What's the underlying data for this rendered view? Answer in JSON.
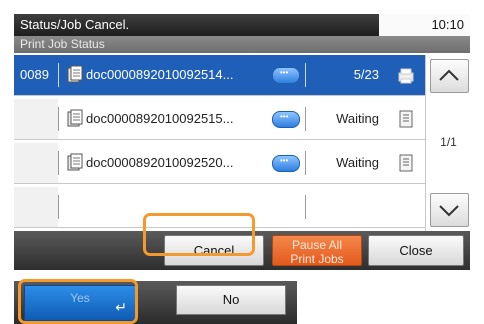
{
  "window": {
    "title": "Status/Job Cancel.",
    "time": "10:10"
  },
  "subtitle": "Print Job Status",
  "jobs": [
    {
      "number": "0089",
      "filename": "doc0000892010092514...",
      "status": "5/23",
      "status_icon": "printer-icon",
      "selected": true
    },
    {
      "number": "",
      "filename": "doc0000892010092515...",
      "status": "Waiting",
      "status_icon": "waiting-doc-icon",
      "selected": false
    },
    {
      "number": "",
      "filename": "doc0000892010092520...",
      "status": "Waiting",
      "status_icon": "waiting-doc-icon",
      "selected": false
    },
    {
      "number": "",
      "filename": "",
      "status": "",
      "status_icon": "",
      "selected": false
    }
  ],
  "scroll": {
    "page_indicator": "1/1",
    "up_icon": "chevron-up-icon",
    "down_icon": "chevron-down-icon"
  },
  "actions": {
    "cancel": "Cancel",
    "pause_line1": "Pause All",
    "pause_line2": "Print Jobs",
    "close": "Close"
  },
  "confirm": {
    "yes": "Yes",
    "no": "No",
    "enter_icon": "enter-icon"
  },
  "colors": {
    "selected_row": "#1f5fb8",
    "highlight": "#f39a2e",
    "pause": "#e35a1c",
    "yes": "#1f7ad6"
  }
}
